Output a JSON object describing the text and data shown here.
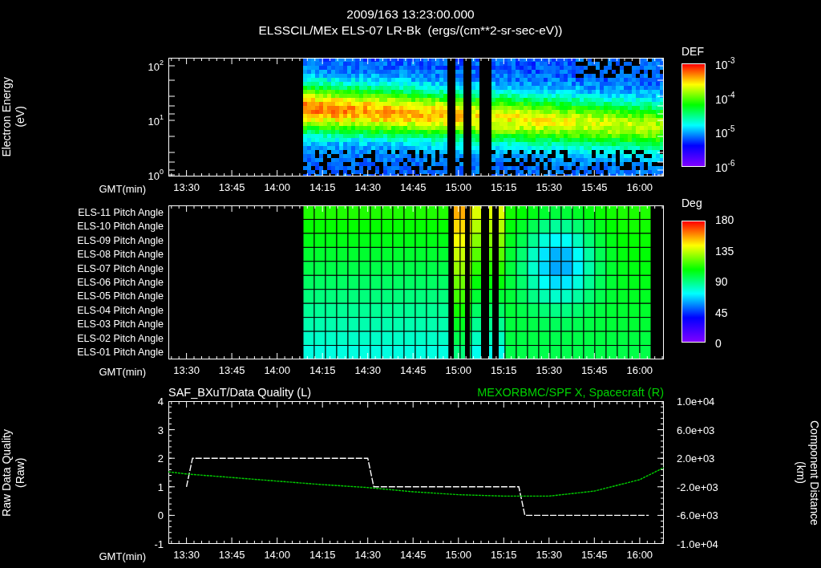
{
  "header": {
    "date": "2009/163 13:23:00.000",
    "title": "ELSSCIL/MEx ELS-07 LR-Bk  (ergs/(cm**2-sr-sec-eV))"
  },
  "energy_panel": {
    "ylabel": "Electron Energy\n(eV)",
    "yticks": [
      "10$^{2}$",
      "10$^{1}$",
      "10$^{0}$"
    ],
    "xlabel": "GMT(min)",
    "xticks": [
      "13:30",
      "13:45",
      "14:00",
      "14:15",
      "14:30",
      "14:45",
      "15:00",
      "15:15",
      "15:30",
      "15:45",
      "16:00"
    ],
    "colorbar": {
      "title": "DEF",
      "labels": [
        "10$^{-3}$",
        "10$^{-4}$",
        "10$^{-5}$",
        "10$^{-6}$"
      ]
    }
  },
  "pitch_panel": {
    "rows": [
      "ELS-11 Pitch Angle",
      "ELS-10 Pitch Angle",
      "ELS-09 Pitch Angle",
      "ELS-08 Pitch Angle",
      "ELS-07 Pitch Angle",
      "ELS-06 Pitch Angle",
      "ELS-05 Pitch Angle",
      "ELS-04 Pitch Angle",
      "ELS-03 Pitch Angle",
      "ELS-02 Pitch Angle",
      "ELS-01 Pitch Angle"
    ],
    "xlabel": "GMT(min)",
    "xticks": [
      "13:30",
      "13:45",
      "14:00",
      "14:15",
      "14:30",
      "14:45",
      "15:00",
      "15:15",
      "15:30",
      "15:45",
      "16:00"
    ],
    "colorbar": {
      "title": "Deg",
      "labels": [
        "180",
        "135",
        "90",
        "45",
        "0"
      ]
    }
  },
  "quality_panel": {
    "left": {
      "ylabel": "Raw Data Quality\n(Raw)",
      "xlabel": "GMT(min)",
      "chart_data": {
        "type": "line",
        "x": [
          810,
          812,
          825,
          840,
          855,
          870,
          872,
          885,
          900,
          915,
          920,
          922,
          930,
          945,
          960,
          963
        ],
        "series": [
          {
            "name": "SAF_BXuT/Data Quality (L)",
            "color": "#ffffff",
            "line_style": "dashed",
            "values": [
              1,
              2,
              2,
              2,
              2,
              2,
              1,
              1,
              1,
              1,
              1,
              0,
              0,
              0,
              0,
              0
            ]
          }
        ],
        "xlim": [
          804,
          968
        ],
        "ylim": [
          -1,
          4
        ],
        "yticks": [
          4,
          3,
          2,
          1,
          0,
          -1
        ],
        "xticks": [
          {
            "value": 810,
            "label": "13:30"
          },
          {
            "value": 825,
            "label": "13:45"
          },
          {
            "value": 840,
            "label": "14:00"
          },
          {
            "value": 855,
            "label": "14:15"
          },
          {
            "value": 870,
            "label": "14:30"
          },
          {
            "value": 885,
            "label": "14:45"
          },
          {
            "value": 900,
            "label": "15:00"
          },
          {
            "value": 915,
            "label": "15:15"
          },
          {
            "value": 930,
            "label": "15:30"
          },
          {
            "value": 945,
            "label": "15:45"
          },
          {
            "value": 960,
            "label": "16:00"
          }
        ]
      }
    },
    "right": {
      "ylabel": "Component Distance\n(km)",
      "chart_data": {
        "type": "line",
        "x": [
          804,
          810,
          825,
          840,
          855,
          870,
          885,
          900,
          915,
          930,
          945,
          960,
          968
        ],
        "series": [
          {
            "name": "MEXORBMC/SPF X, Spacecraft (R)",
            "color": "#00d000",
            "line_style": "dotted",
            "values": [
              100,
              -200,
              -700,
              -1200,
              -1700,
              -2100,
              -2700,
              -3100,
              -3300,
              -3300,
              -2600,
              -1000,
              700
            ]
          }
        ],
        "xlim": [
          804,
          968
        ],
        "ylim": [
          -10000,
          10000
        ],
        "yticks": [
          {
            "value": 10000,
            "label": "1.0e+04"
          },
          {
            "value": 6000,
            "label": "6.0e+03"
          },
          {
            "value": 2000,
            "label": "2.0e+03"
          },
          {
            "value": -2000,
            "label": "-2.0e+03"
          },
          {
            "value": -6000,
            "label": "-6.0e+03"
          },
          {
            "value": -10000,
            "label": "-1.0e+04"
          }
        ]
      }
    }
  }
}
